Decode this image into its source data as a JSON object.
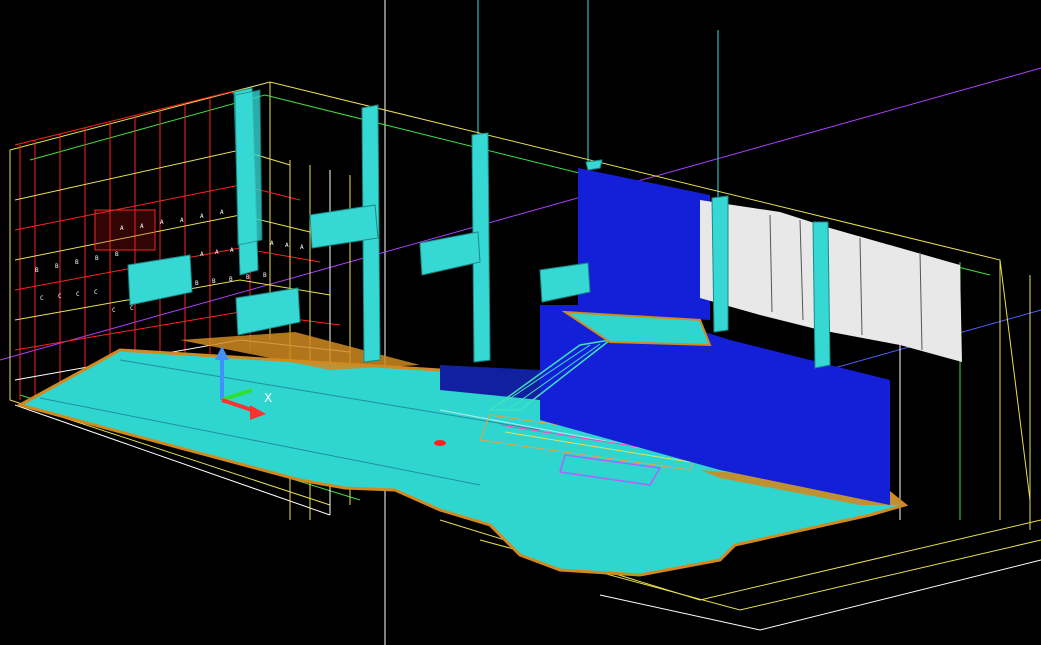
{
  "viewport": {
    "background": "#000000"
  },
  "colors": {
    "floor": "#2fd6d0",
    "floor_edge": "#d08a20",
    "column": "#36d8d4",
    "screen_blue": "#1420d8",
    "wall_white": "#e8e8e8",
    "wire_red": "#ff2020",
    "wire_yellow": "#e8e050",
    "wire_green": "#40e040",
    "wire_cyan": "#30e0e0",
    "wire_magenta": "#c040ff",
    "wire_white": "#ffffff",
    "stair": "#40e0c0",
    "marker_red": "#ff2020"
  },
  "ucs": {
    "x_label": "X",
    "colors": {
      "x": "#ff3030",
      "y": "#30e030",
      "z": "#4090ff"
    }
  },
  "seat_rows": {
    "row_a": [
      "A",
      "A",
      "A",
      "A",
      "A",
      "A",
      "A",
      "A",
      "A",
      "A",
      "A",
      "A"
    ],
    "row_b": [
      "B",
      "B",
      "B",
      "B",
      "B",
      "B",
      "B",
      "B",
      "B",
      "B"
    ],
    "row_c": [
      "C",
      "C",
      "C",
      "C",
      "C",
      "C",
      "C",
      "C",
      "C",
      "C"
    ]
  },
  "icons": {
    "ucs": "ucs-axis-icon",
    "marker": "location-marker-icon"
  }
}
